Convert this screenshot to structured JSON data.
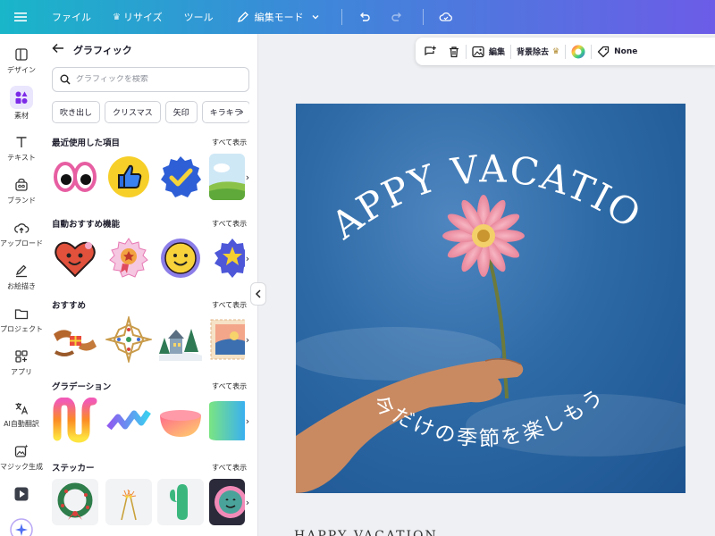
{
  "topbar": {
    "file": "ファイル",
    "resize": "リサイズ",
    "tools": "ツール",
    "edit_mode": "編集モード"
  },
  "rail": {
    "items": [
      {
        "label": "デザイン",
        "icon": "layout-icon"
      },
      {
        "label": "素材",
        "icon": "shapes-icon"
      },
      {
        "label": "テキスト",
        "icon": "text-icon"
      },
      {
        "label": "ブランド",
        "icon": "brand-icon"
      },
      {
        "label": "アップロード",
        "icon": "cloud-upload-icon"
      },
      {
        "label": "お絵描き",
        "icon": "draw-icon"
      },
      {
        "label": "プロジェクト",
        "icon": "folder-icon"
      },
      {
        "label": "アプリ",
        "icon": "apps-icon"
      },
      {
        "label": "AI自動翻訳",
        "icon": "translate-icon"
      },
      {
        "label": "マジック生成",
        "icon": "magic-image-icon"
      }
    ]
  },
  "panel": {
    "title": "グラフィック",
    "search_placeholder": "グラフィックを検索",
    "chips": [
      "吹き出し",
      "クリスマス",
      "矢印",
      "キラキラ"
    ],
    "see_all": "すべて表示",
    "sections": [
      {
        "title": "最近使用した項目"
      },
      {
        "title": "自動おすすめ機能"
      },
      {
        "title": "おすすめ"
      },
      {
        "title": "グラデーション"
      },
      {
        "title": "ステッカー"
      }
    ]
  },
  "context_toolbar": {
    "edit": "編集",
    "bg_remove": "背景除去",
    "link_value": "None"
  },
  "design": {
    "headline": "HAPPY VACATION!",
    "subline": "今だけの季節を楽しもう",
    "below_text": "HAPPY VACATION"
  },
  "colors": {
    "accent": "#7d2ae8",
    "topbar_start": "#19b6c9",
    "topbar_end": "#6c5ce7"
  }
}
